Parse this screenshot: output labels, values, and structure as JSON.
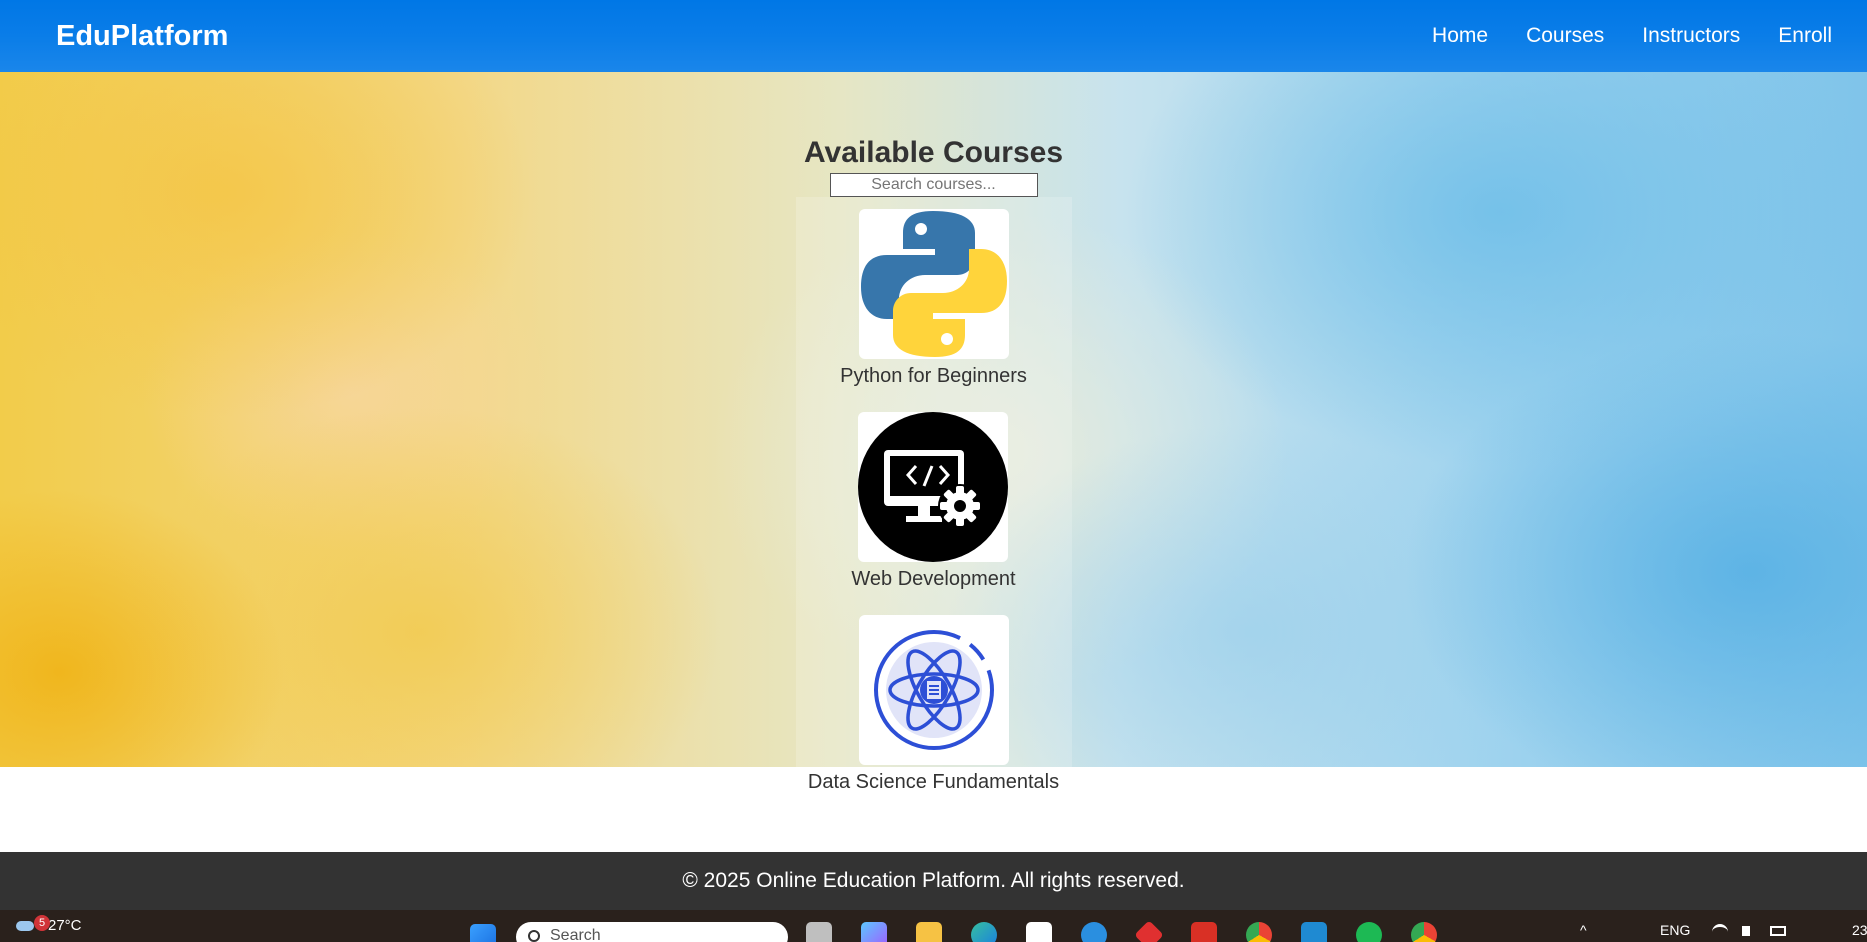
{
  "header": {
    "brand": "EduPlatform",
    "nav": [
      "Home",
      "Courses",
      "Instructors",
      "Enroll"
    ]
  },
  "main": {
    "title": "Available Courses",
    "search_placeholder": "Search courses...",
    "courses": [
      {
        "title": "Python for Beginners",
        "icon": "python-logo-icon"
      },
      {
        "title": "Web Development",
        "icon": "monitor-code-gear-icon"
      },
      {
        "title": "Data Science Fundamentals",
        "icon": "atom-document-icon"
      }
    ]
  },
  "footer": {
    "text": "© 2025 Online Education Platform. All rights reserved."
  },
  "taskbar": {
    "weather_badge": "5",
    "temperature": "27°C",
    "search_text": "Search",
    "language": "ENG",
    "clock_fragment": "23"
  },
  "colors": {
    "header_bg": "#0077e6",
    "footer_bg": "#333333",
    "python_blue": "#3776ab",
    "python_yellow": "#ffd43b",
    "atom_blue": "#2d4fd6"
  }
}
